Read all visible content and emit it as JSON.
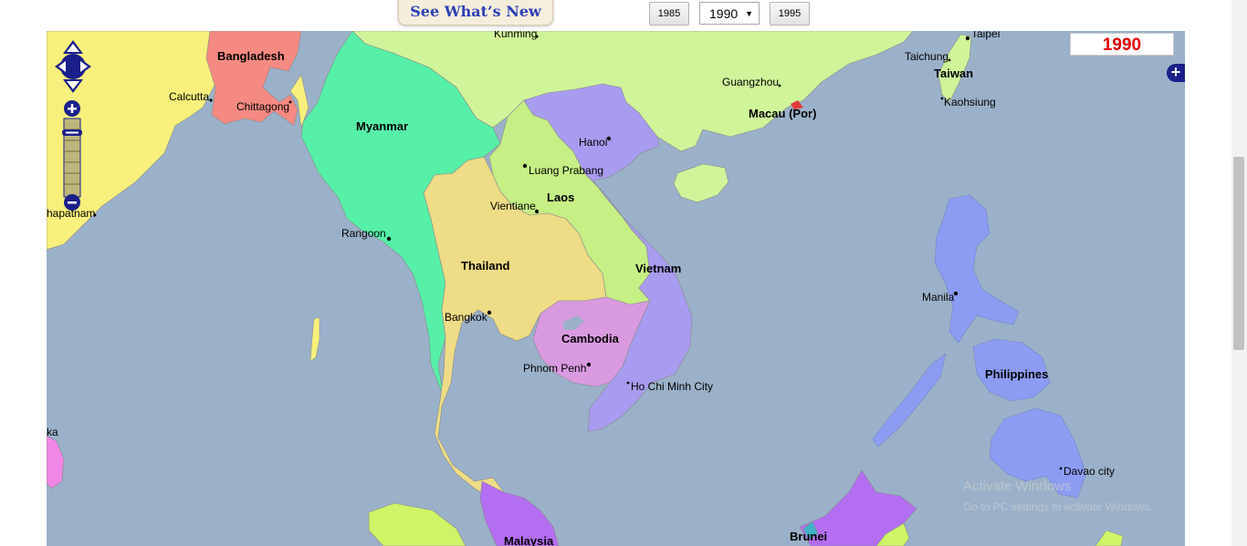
{
  "header": {
    "whats_new": "See What’s New",
    "prev_year": "1985",
    "selected_year": "1990",
    "next_year": "1995"
  },
  "map": {
    "year_display": "1990",
    "expand_symbol": "+",
    "countries": {
      "bangladesh": "Bangladesh",
      "myanmar": "Myanmar",
      "laos": "Laos",
      "thailand": "Thailand",
      "vietnam": "Vietnam",
      "cambodia": "Cambodia",
      "taiwan": "Taiwan",
      "macau": "Macau (Por)",
      "philippines": "Philippines",
      "malaysia": "Malaysia",
      "brunei": "Brunei"
    },
    "cities": {
      "kunming": "Kunming",
      "taipei": "Taipei",
      "taichung": "Taichung",
      "kaohsiung": "Kaohsiung",
      "guangzhou": "Guangzhou",
      "calcutta": "Calcutta",
      "chittagong": "Chittagong",
      "hanoi": "Hanoi",
      "luang_prabang": "Luang Prabang",
      "vientiane": "Vientiane",
      "vishakhapatnam": "hapatnam",
      "rangoon": "Rangoon",
      "bangkok": "Bangkok",
      "phnom_penh": "Phnom Penh",
      "ho_chi_minh": "Ho Chi Minh City",
      "manila": "Manila",
      "davao": "Davao city",
      "sri_lanka_partial": "ka"
    },
    "colors": {
      "sea": "#9ab1c9",
      "india": "#f8f07c",
      "bangladesh": "#f58a82",
      "myanmar": "#56f0a8",
      "china": "#cff49a",
      "laos": "#c6ef86",
      "vietnam": "#a89cf0",
      "thailand": "#efdc86",
      "cambodia": "#d99ae0",
      "philippines": "#8c9cf2",
      "malaysia": "#b46ef2",
      "year_text": "#e00000"
    }
  },
  "watermark": {
    "line1": "Activate Windows",
    "line2": "Go to PC settings to activate Windows."
  }
}
